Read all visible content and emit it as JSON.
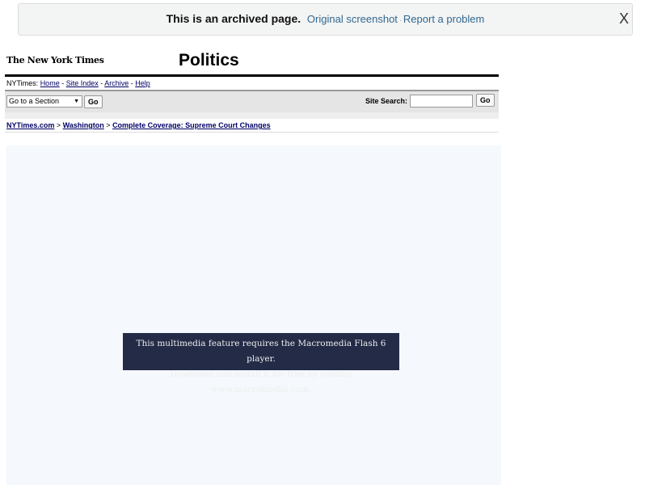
{
  "banner": {
    "message": "This is an archived page.",
    "link1": "Original screenshot",
    "separator": "·",
    "link2": "Report a problem",
    "close": "X"
  },
  "header": {
    "logo": "The New York Times",
    "title": "Politics"
  },
  "nav": {
    "prefix": "NYTimes:",
    "items": [
      "Home",
      "Site Index",
      "Archive",
      "Help"
    ],
    "separator": " - "
  },
  "toolbar": {
    "section_select": "Go to a Section",
    "go1": "Go",
    "search_label": "Site Search:",
    "search_value": "",
    "go2": "Go"
  },
  "breadcrumb": {
    "items": [
      "NYTimes.com",
      "Washington",
      "Complete Coverage: Supreme Court Changes"
    ],
    "separator": " > "
  },
  "flash": {
    "line1": "This multimedia feature requires the Macromedia Flash 6 player.",
    "line2": "Download and install it for free by visiting www.macromedia.com."
  }
}
